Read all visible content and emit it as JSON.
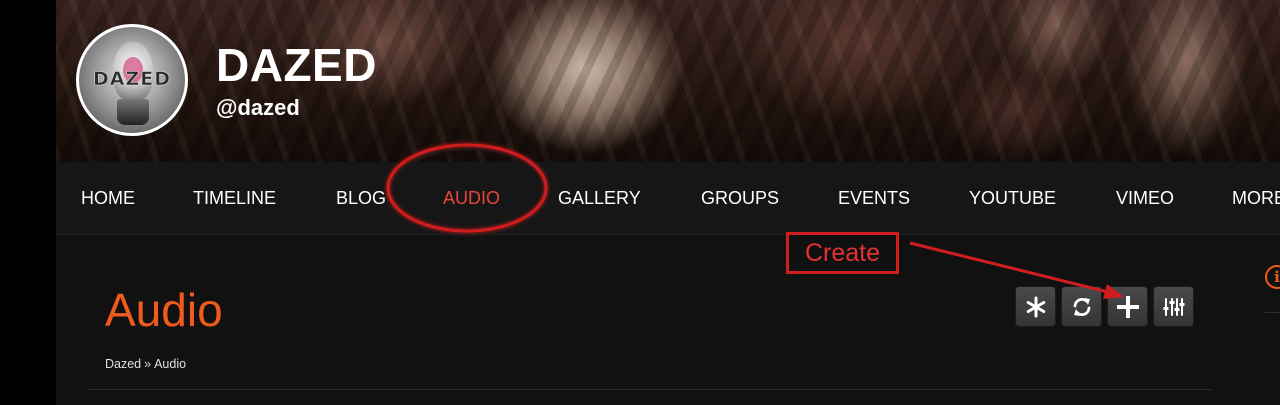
{
  "profile": {
    "avatar_text": "DAZED",
    "name": "DAZED",
    "handle": "@dazed"
  },
  "nav": {
    "items": [
      {
        "label": "HOME"
      },
      {
        "label": "TIMELINE"
      },
      {
        "label": "BLOG"
      },
      {
        "label": "AUDIO",
        "active": true
      },
      {
        "label": "GALLERY"
      },
      {
        "label": "GROUPS"
      },
      {
        "label": "EVENTS"
      },
      {
        "label": "YOUTUBE"
      },
      {
        "label": "VIMEO"
      },
      {
        "label": "MORE"
      }
    ]
  },
  "content": {
    "title": "Audio",
    "breadcrumb": {
      "root": "Dazed",
      "separator": "»",
      "current": "Audio"
    },
    "toolbar": [
      {
        "icon": "asterisk-icon"
      },
      {
        "icon": "refresh-icon"
      },
      {
        "icon": "plus-icon"
      },
      {
        "icon": "sliders-icon"
      }
    ]
  },
  "annotation": {
    "label": "Create"
  },
  "colors": {
    "accent_orange": "#ef5b1d",
    "active_red": "#e8463a",
    "annotation_red": "#d01e1e",
    "background": "#111111"
  }
}
